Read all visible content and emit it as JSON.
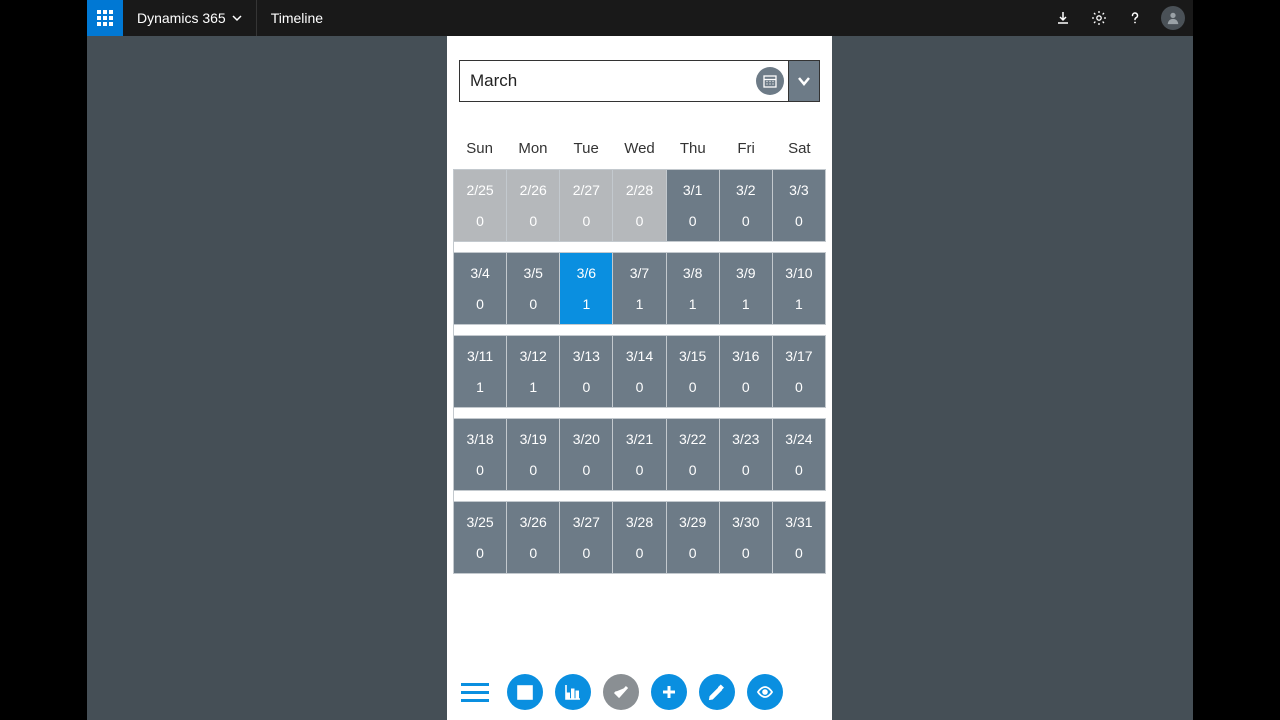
{
  "header": {
    "brand": "Dynamics 365",
    "crumb": "Timeline"
  },
  "month_picker": {
    "value": "March"
  },
  "calendar": {
    "dow": [
      "Sun",
      "Mon",
      "Tue",
      "Wed",
      "Thu",
      "Fri",
      "Sat"
    ],
    "days": [
      {
        "d": "2/25",
        "c": "0",
        "state": "out"
      },
      {
        "d": "2/26",
        "c": "0",
        "state": "out"
      },
      {
        "d": "2/27",
        "c": "0",
        "state": "out"
      },
      {
        "d": "2/28",
        "c": "0",
        "state": "out"
      },
      {
        "d": "3/1",
        "c": "0",
        "state": ""
      },
      {
        "d": "3/2",
        "c": "0",
        "state": ""
      },
      {
        "d": "3/3",
        "c": "0",
        "state": ""
      },
      {
        "d": "3/4",
        "c": "0",
        "state": ""
      },
      {
        "d": "3/5",
        "c": "0",
        "state": ""
      },
      {
        "d": "3/6",
        "c": "1",
        "state": "sel"
      },
      {
        "d": "3/7",
        "c": "1",
        "state": ""
      },
      {
        "d": "3/8",
        "c": "1",
        "state": ""
      },
      {
        "d": "3/9",
        "c": "1",
        "state": ""
      },
      {
        "d": "3/10",
        "c": "1",
        "state": ""
      },
      {
        "d": "3/11",
        "c": "1",
        "state": ""
      },
      {
        "d": "3/12",
        "c": "1",
        "state": ""
      },
      {
        "d": "3/13",
        "c": "0",
        "state": ""
      },
      {
        "d": "3/14",
        "c": "0",
        "state": ""
      },
      {
        "d": "3/15",
        "c": "0",
        "state": ""
      },
      {
        "d": "3/16",
        "c": "0",
        "state": ""
      },
      {
        "d": "3/17",
        "c": "0",
        "state": ""
      },
      {
        "d": "3/18",
        "c": "0",
        "state": ""
      },
      {
        "d": "3/19",
        "c": "0",
        "state": ""
      },
      {
        "d": "3/20",
        "c": "0",
        "state": ""
      },
      {
        "d": "3/21",
        "c": "0",
        "state": ""
      },
      {
        "d": "3/22",
        "c": "0",
        "state": ""
      },
      {
        "d": "3/23",
        "c": "0",
        "state": ""
      },
      {
        "d": "3/24",
        "c": "0",
        "state": ""
      },
      {
        "d": "3/25",
        "c": "0",
        "state": ""
      },
      {
        "d": "3/26",
        "c": "0",
        "state": ""
      },
      {
        "d": "3/27",
        "c": "0",
        "state": ""
      },
      {
        "d": "3/28",
        "c": "0",
        "state": ""
      },
      {
        "d": "3/29",
        "c": "0",
        "state": ""
      },
      {
        "d": "3/30",
        "c": "0",
        "state": ""
      },
      {
        "d": "3/31",
        "c": "0",
        "state": ""
      }
    ]
  }
}
